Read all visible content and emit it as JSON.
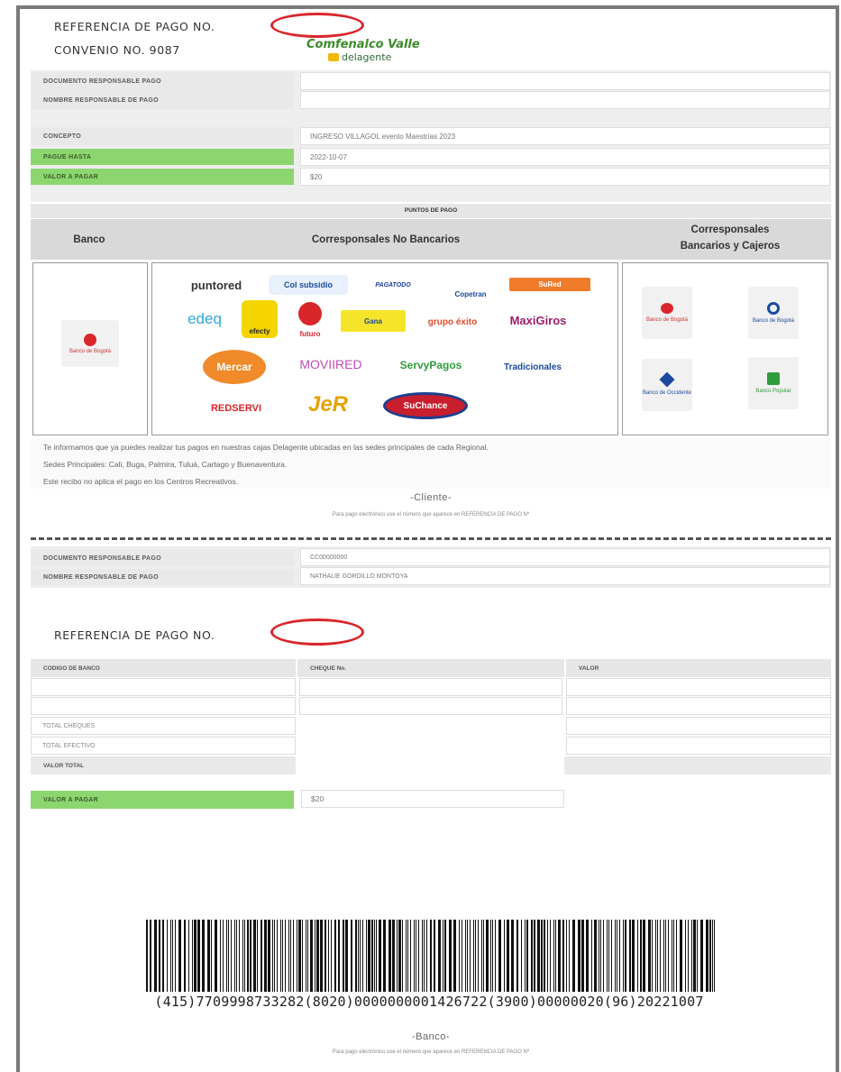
{
  "header": {
    "referencia": "REFERENCIA DE PAGO NO.",
    "convenio": "CONVENIO NO. 9087",
    "brand_name": "Comfenalco Valle",
    "brand_sub": "delagente"
  },
  "top_rows": [
    {
      "label": "DOCUMENTO RESPONSABLE PAGO",
      "value": ""
    },
    {
      "label": "NOMBRE RESPONSABLE DE PAGO",
      "value": ""
    }
  ],
  "detail_rows": [
    {
      "label": "CONCEPTO",
      "value": "INGRESO VILLAGOL evento Maestrías 2023",
      "green": false
    },
    {
      "label": "PAGUE HASTA",
      "value": "2022-10-07",
      "green": true
    },
    {
      "label": "VALOR A PAGAR",
      "value": "$20",
      "green": true
    }
  ],
  "puntos": {
    "title": "PUNTOS DE PAGO",
    "col_banco": "Banco",
    "col_corresponsales": "Corresponsales No Bancarios",
    "col_cajeros_1": "Corresponsales",
    "col_cajeros_2": "Bancarios  y Cajeros",
    "banco_tile": "Banco de Bogotá",
    "logos": {
      "puntored": "puntored",
      "colsubsidio": "Col subsidio",
      "paga_todo": "PAGATODO",
      "coopetrans": "Copetran",
      "sured": "SuRed",
      "edeq": "edeq",
      "efecty": "efecty",
      "futuro": "futuro",
      "gana": "Gana",
      "grupo_exito": "grupo éxito",
      "maxi_giros": "MaxiGiros",
      "mercar": "Mercar",
      "movired": "MOVIIRED",
      "servipagos": "ServyPagos",
      "tradicionales": "Tradicionales",
      "redservi": "REDSERVI",
      "jer": "JeR",
      "sufianzo": "SuChance"
    },
    "cajeros": [
      "Banco de Bogotá",
      "Banco de Bogotá",
      "Banco de Occidente",
      "Banco Popular"
    ]
  },
  "info_lines": [
    "Te informamos que ya puedes realizar tus pagos en nuestras cajas Delagente ubicadas en las sedes principales de cada Regional.",
    "Sedes Principales: Cali, Buga, Palmira, Tuluá, Cartago y Buenaventura.",
    "Este recibo no aplica el pago en los Centros Recreativos."
  ],
  "cliente_label": "-Cliente-",
  "cliente_note": "Para pago electrónico use el número que aparece en REFERENCIA DE PAGO Nº",
  "bottom_rows": [
    {
      "label": "DOCUMENTO RESPONSABLE PAGO",
      "value": "CC00000000"
    },
    {
      "label": "NOMBRE RESPONSABLE DE PAGO",
      "value": "NATHALIE GORDILLO MONTOYA"
    }
  ],
  "referencia2": "REFERENCIA DE PAGO NO.",
  "cheques_table": {
    "headers": [
      "CODIGO DE BANCO",
      "CHEQUE No.",
      "VALOR"
    ],
    "total_cheques": "TOTAL CHEQUES",
    "total_efectivo": "TOTAL EFECTIVO",
    "valor_total": "VALOR TOTAL"
  },
  "valor_pagar": {
    "label": "VALOR A PAGAR",
    "value": "$20"
  },
  "barcode_text": "(415)7709998733282(8020)0000000001426722(3900)00000020(96)20221007",
  "banco_label": "-Banco-",
  "banco_note": "Para pago electrónico use el número que aparece en REFERENCIA DE PAGO Nº"
}
